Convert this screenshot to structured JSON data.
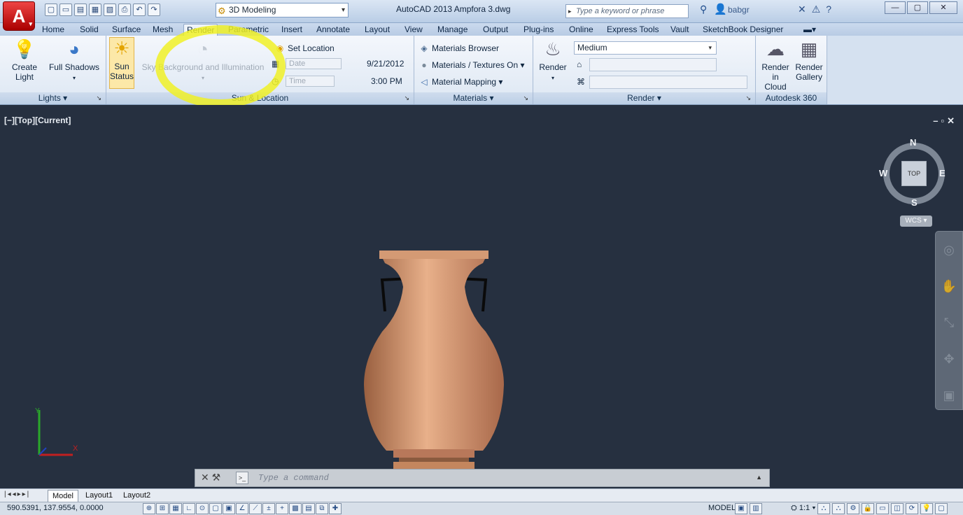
{
  "titlebar": {
    "app_letter": "A",
    "workspace": "3D Modeling",
    "title": "AutoCAD 2013   Ampfora 3.dwg",
    "search_placeholder": "Type a keyword or phrase",
    "username": "babgr"
  },
  "tabs": [
    "Home",
    "Solid",
    "Surface",
    "Mesh",
    "Render",
    "Parametric",
    "Insert",
    "Annotate",
    "Layout",
    "View",
    "Manage",
    "Output",
    "Plug-ins",
    "Online",
    "Express Tools",
    "Vault",
    "SketchBook Designer"
  ],
  "active_tab": "Render",
  "ribbon": {
    "lights": {
      "create_light": "Create",
      "create_light_2": "Light",
      "full_shadows": "Full Shadows",
      "title": "Lights"
    },
    "sun_location": {
      "sun_status": "Sun",
      "sun_status_2": "Status",
      "sky": "Sky Background and Illumination",
      "set_location": "Set Location",
      "date_label": "Date",
      "date_value": "9/21/2012",
      "time_label": "Time",
      "time_value": "3:00 PM",
      "title": "Sun & Location"
    },
    "materials": {
      "browser": "Materials Browser",
      "textures": "Materials / Textures On",
      "mapping": "Material Mapping",
      "title": "Materials"
    },
    "render": {
      "render_label": "Render",
      "quality": "Medium",
      "title": "Render"
    },
    "autodesk360": {
      "cloud": "Render in",
      "cloud_2": "Cloud",
      "gallery": "Render",
      "gallery_2": "Gallery",
      "title": "Autodesk 360"
    }
  },
  "viewport": {
    "label": "[−][Top][Current]",
    "viewcube": {
      "n": "N",
      "s": "S",
      "e": "E",
      "w": "W",
      "top": "TOP",
      "wcs": "WCS"
    }
  },
  "command": {
    "placeholder": "Type a command"
  },
  "layout_tabs": [
    "Model",
    "Layout1",
    "Layout2"
  ],
  "status": {
    "coords": "590.5391, 137.9554, 0.0000",
    "model": "MODEL",
    "annoscale": "1:1"
  },
  "colors": {
    "viewport_bg": "#263040",
    "vase": "#c98a62",
    "highlight": "#f0f01e"
  }
}
